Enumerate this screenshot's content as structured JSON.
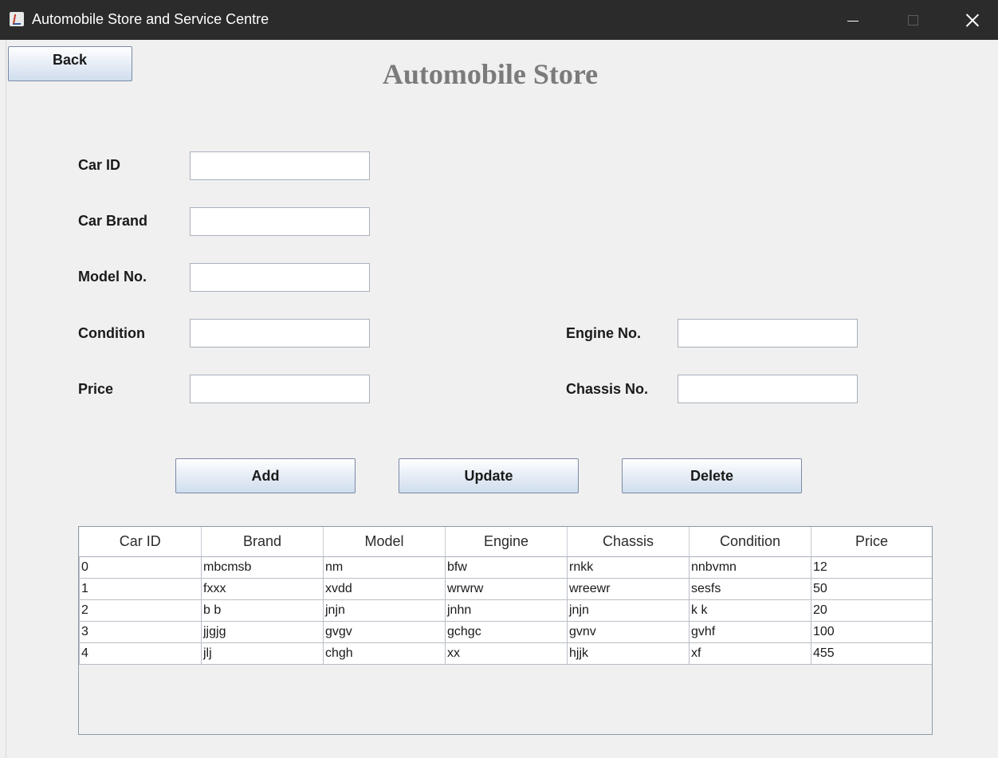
{
  "window": {
    "title": "Automobile Store and Service Centre",
    "icon": "java-coffee-cup-icon"
  },
  "header": {
    "back_label": "Back",
    "page_title": "Automobile Store"
  },
  "form": {
    "car_id_label": "Car  ID",
    "car_brand_label": "Car  Brand",
    "model_no_label": "Model No.",
    "condition_label": "Condition",
    "price_label": "Price",
    "engine_no_label": "Engine No.",
    "chassis_no_label": "Chassis No.",
    "car_id_value": "",
    "car_brand_value": "",
    "model_no_value": "",
    "condition_value": "",
    "price_value": "",
    "engine_no_value": "",
    "chassis_no_value": ""
  },
  "actions": {
    "add_label": "Add",
    "update_label": "Update",
    "delete_label": "Delete"
  },
  "table": {
    "columns": [
      "Car ID",
      "Brand",
      "Model",
      "Engine",
      "Chassis",
      "Condition",
      "Price"
    ],
    "rows": [
      [
        "0",
        "mbcmsb",
        "nm",
        "bfw",
        "rnkk",
        "nnbvmn",
        "12"
      ],
      [
        "1",
        "fxxx",
        "xvdd",
        "wrwrw",
        "wreewr",
        "sesfs",
        "50"
      ],
      [
        "2",
        "b b",
        "jnjn",
        "jnhn",
        "jnjn",
        " k k",
        "20"
      ],
      [
        "3",
        "jjgjg",
        "gvgv",
        "gchgc",
        "gvnv",
        "gvhf",
        "100"
      ],
      [
        "4",
        "jlj",
        "chgh",
        "xx",
        "hjjk",
        "xf",
        "455"
      ]
    ]
  }
}
